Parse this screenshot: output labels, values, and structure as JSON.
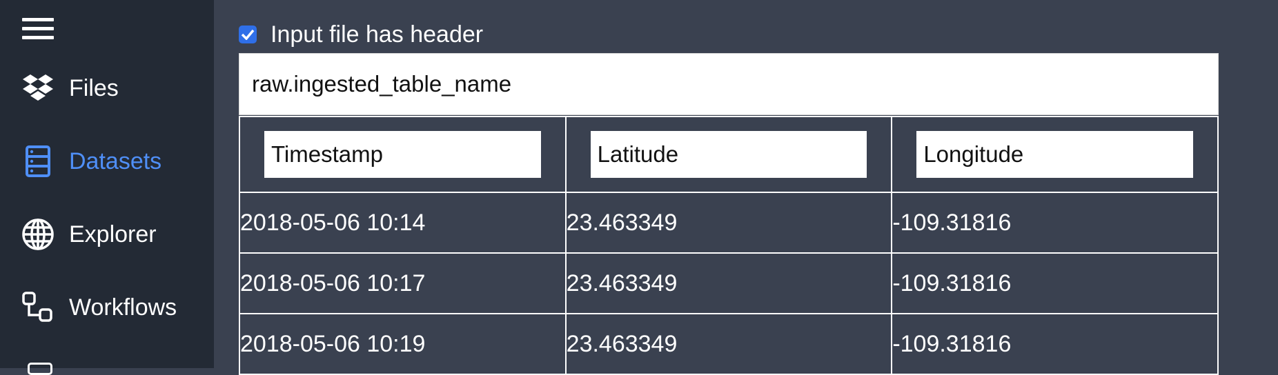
{
  "sidebar": {
    "items": [
      {
        "label": "Files",
        "icon": "dropbox-icon"
      },
      {
        "label": "Datasets",
        "icon": "database-icon",
        "active": true
      },
      {
        "label": "Explorer",
        "icon": "globe-icon"
      },
      {
        "label": "Workflows",
        "icon": "workflow-icon"
      }
    ]
  },
  "main": {
    "has_header_checked": true,
    "has_header_label": "Input file has header",
    "table_name": "raw.ingested_table_name",
    "columns": [
      "Timestamp",
      "Latitude",
      "Longitude"
    ],
    "rows": [
      [
        "2018-05-06 10:14",
        "23.463349",
        "-109.31816"
      ],
      [
        "2018-05-06 10:17",
        "23.463349",
        "-109.31816"
      ],
      [
        "2018-05-06 10:19",
        "23.463349",
        "-109.31816"
      ]
    ]
  },
  "colors": {
    "sidebar_bg": "#232a35",
    "main_bg": "#3a4150",
    "accent": "#4f8ff7"
  }
}
